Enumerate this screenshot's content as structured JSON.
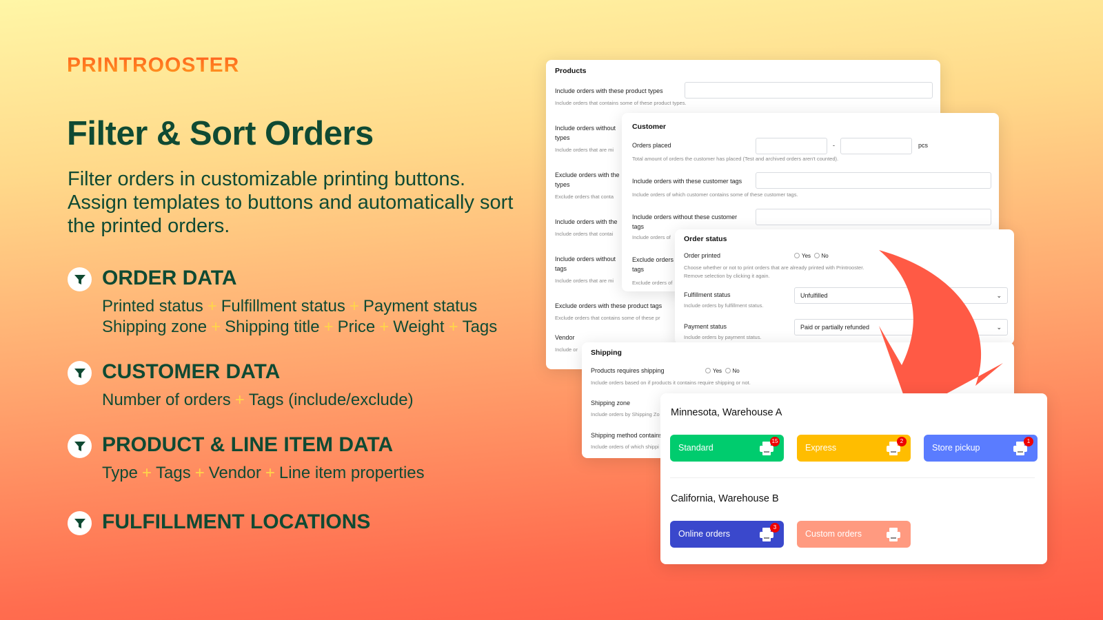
{
  "brand": {
    "logo": "PRINTROOSTER"
  },
  "hero": {
    "title": "Filter & Sort Orders",
    "subtitle": "Filter orders in customizable printing buttons. Assign templates to buttons and automatically sort the printed orders."
  },
  "sections": [
    {
      "heading": "ORDER DATA",
      "lines": [
        [
          "Printed status",
          "Fulfillment status",
          "Payment status"
        ],
        [
          "Shipping zone",
          "Shipping title",
          "Price",
          "Weight",
          "Tags"
        ]
      ]
    },
    {
      "heading": "CUSTOMER DATA",
      "lines": [
        [
          "Number of orders",
          "Tags (include/exclude)"
        ]
      ]
    },
    {
      "heading": "PRODUCT & LINE ITEM DATA",
      "lines": [
        [
          "Type",
          "Tags",
          "Vendor",
          "Line item properties"
        ]
      ]
    },
    {
      "heading": "FULFILLMENT LOCATIONS",
      "lines": []
    }
  ],
  "plus": "+",
  "products_panel": {
    "title": "Products",
    "rows": [
      {
        "label": "Include orders with these product types",
        "help": "Include orders that contains some of these product types."
      },
      {
        "label": "Include orders without types",
        "help": "Include orders that are mi"
      },
      {
        "label": "Exclude orders with the types",
        "help": "Exclude orders that conta"
      },
      {
        "label": "Include orders with the",
        "help": "Include orders that contai"
      },
      {
        "label": "Include orders without tags",
        "help": "Include orders that are mi"
      },
      {
        "label": "Exclude orders with these product tags",
        "help": "Exclude orders that contains some of these pr"
      },
      {
        "label": "Vendor",
        "help": "Include or"
      }
    ]
  },
  "customer_panel": {
    "title": "Customer",
    "orders_placed": "Orders placed",
    "dash": "-",
    "unit": "pcs",
    "orders_help": "Total amount of orders the customer has placed (Test and archived orders aren't counted).",
    "incl_tags": "Include orders with these customer tags",
    "incl_help": "Include orders of which customer contains some of these customer tags.",
    "excl_tags": "Include orders without these customer tags",
    "excl_help": "Include orders of",
    "excl2": "Exclude orders tags",
    "excl2_help": "Exclude orders of"
  },
  "order_status_panel": {
    "title": "Order status",
    "printed": "Order printed",
    "yes": "Yes",
    "no": "No",
    "printed_help": "Choose whether or not to print orders that are already printed with Printrooster. Remove selection by clicking it again.",
    "fulfillment": "Fulfillment status",
    "fulfillment_value": "Unfulfilled",
    "fulfillment_help": "Include orders by fulfillment status.",
    "payment": "Payment status",
    "payment_value": "Paid or partially refunded",
    "payment_help": "Include orders by payment status."
  },
  "shipping_panel": {
    "title": "Shipping",
    "requires": "Products requires shipping",
    "yes": "Yes",
    "no": "No",
    "requires_help": "Include orders based on if products it contains require shipping or not.",
    "zone": "Shipping zone",
    "zone_help": "Include orders by Shipping Zo",
    "method": "Shipping method contains",
    "method_help": "Include orders of which shippi"
  },
  "warehouses": [
    {
      "name": "Minnesota, Warehouse A",
      "buttons": [
        {
          "label": "Standard",
          "count": "15",
          "color": "#00cc6e"
        },
        {
          "label": "Express",
          "count": "2",
          "color": "#ffbd00"
        },
        {
          "label": "Store pickup",
          "count": "1",
          "color": "#5a7cff"
        }
      ]
    },
    {
      "name": "California, Warehouse B",
      "buttons": [
        {
          "label": "Online orders",
          "count": "3",
          "color": "#3a48cc"
        },
        {
          "label": "Custom orders",
          "count": "",
          "color": "#ff9a80"
        }
      ]
    }
  ],
  "colors": {
    "text": "#0f4a33",
    "arrow": "#ff5a45",
    "badge": "#ee0000"
  }
}
